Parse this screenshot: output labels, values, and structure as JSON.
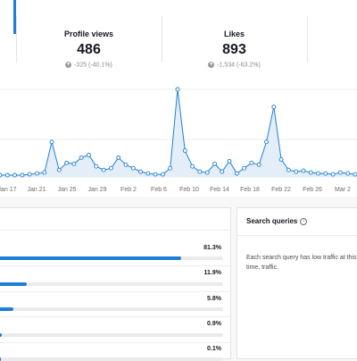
{
  "stats": [
    {
      "label": "Profile views",
      "value": "486",
      "delta": "-325 (-40.1%)"
    },
    {
      "label": "Likes",
      "value": "893",
      "delta": "-1,534 (-63.2%)"
    }
  ],
  "chart_data": {
    "type": "area",
    "title": "",
    "xlabel": "",
    "ylabel": "",
    "x_ticks": [
      "Jan 17",
      "Jan 21",
      "Jan 25",
      "Jan 29",
      "Feb 2",
      "Feb 6",
      "Feb 10",
      "Feb 14",
      "Feb 18",
      "Feb 22",
      "Feb 26",
      "Mar 2"
    ],
    "series": [
      {
        "values": [
          2,
          2,
          2,
          2,
          3,
          4,
          5,
          40,
          8,
          16,
          15,
          22,
          25,
          12,
          8,
          10,
          22,
          14,
          10,
          6,
          4,
          3,
          3,
          10,
          100,
          30,
          12,
          6,
          5,
          15,
          6,
          18,
          4,
          10,
          16,
          14,
          40,
          80,
          20,
          8,
          6,
          7,
          5,
          4,
          4,
          3,
          5,
          4,
          3
        ]
      }
    ],
    "color": "#1f7fd6",
    "grid": true
  },
  "traffic_sources": [
    {
      "percent": "81.3%",
      "fraction": 0.813
    },
    {
      "percent": "11.9%",
      "fraction": 0.119
    },
    {
      "percent": "5.8%",
      "fraction": 0.058
    },
    {
      "percent": "0.9%",
      "fraction": 0.009
    },
    {
      "percent": "0.1%",
      "fraction": 0.001
    }
  ],
  "search_queries": {
    "title": "Search queries",
    "info_icon": "info-icon",
    "empty_text": "Each search query has low traffic at this time, traffic."
  }
}
